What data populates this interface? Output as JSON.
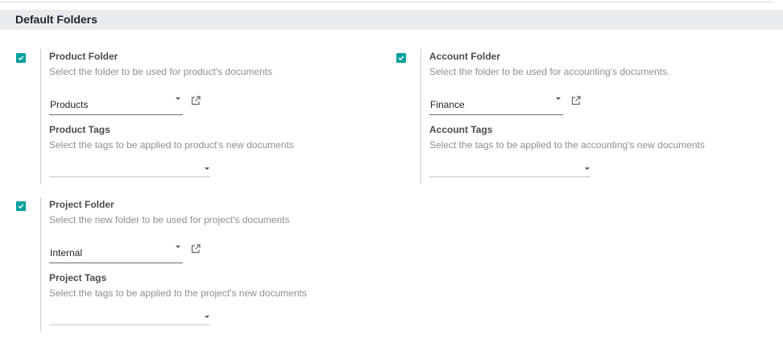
{
  "section": {
    "title": "Default Folders"
  },
  "settings": [
    {
      "label": "Product Folder",
      "description": "Select the folder to be used for product's documents",
      "folder_value": "Products",
      "tags_label": "Product Tags",
      "tags_description": "Select the tags to be applied to product's new documents",
      "tags_value": ""
    },
    {
      "label": "Account Folder",
      "description": "Select the folder to be used for accounting's documents.",
      "folder_value": "Finance",
      "tags_label": "Account Tags",
      "tags_description": "Select the tags to be applied to the accounting's new documents",
      "tags_value": ""
    },
    {
      "label": "Project Folder",
      "description": "Select the new folder to be used for project's documents",
      "folder_value": "Internal",
      "tags_label": "Project Tags",
      "tags_description": "Select the tags to be applied to the project's new documents",
      "tags_value": ""
    }
  ],
  "icons": {
    "checkbox": "checkmark-icon",
    "external_link": "external-link-icon",
    "dropdown": "caret-down-icon"
  },
  "colors": {
    "accent": "#00a09d",
    "header_bg": "#e9ecef",
    "muted_text": "#8f8f8f"
  }
}
